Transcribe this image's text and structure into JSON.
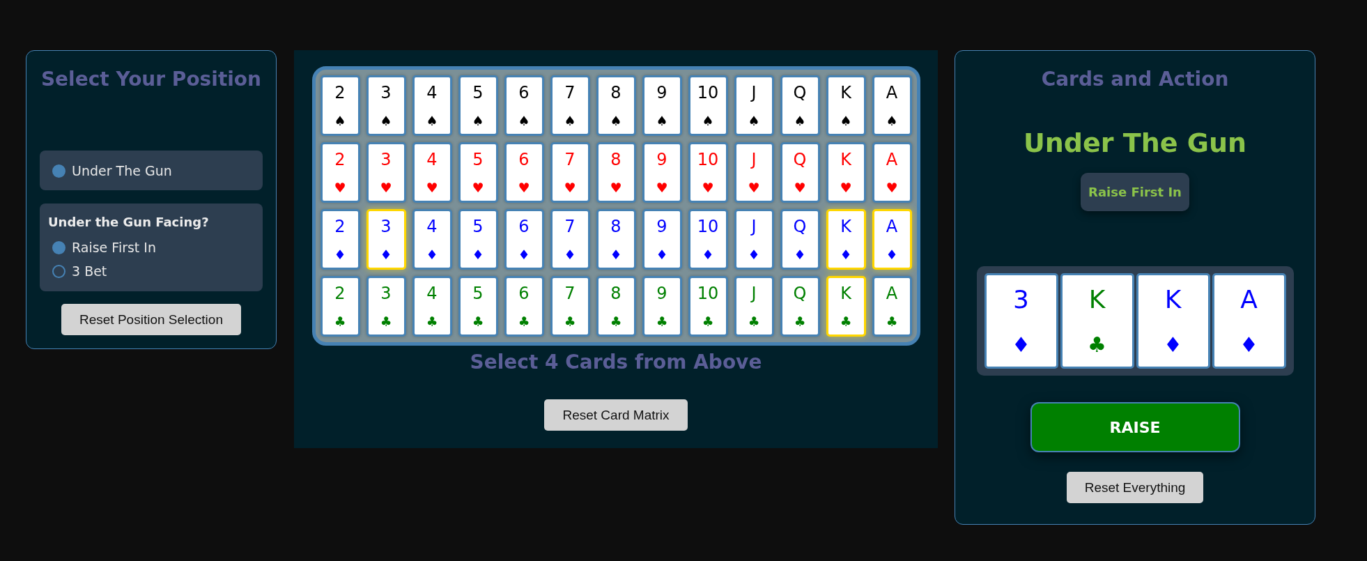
{
  "position_panel": {
    "title": "Select Your Position",
    "positions": [
      {
        "label": "Under The Gun",
        "selected": true
      }
    ],
    "facing": {
      "heading": "Under the Gun Facing?",
      "options": [
        {
          "label": "Raise First In",
          "selected": true
        },
        {
          "label": "3 Bet",
          "selected": false
        }
      ]
    },
    "reset_button": "Reset Position Selection"
  },
  "card_matrix": {
    "rows": [
      {
        "color": "#000000",
        "cards": [
          {
            "rank": "2",
            "suit": "♠",
            "selected": false
          },
          {
            "rank": "3",
            "suit": "♠",
            "selected": false
          },
          {
            "rank": "4",
            "suit": "♠",
            "selected": false
          },
          {
            "rank": "5",
            "suit": "♠",
            "selected": false
          },
          {
            "rank": "6",
            "suit": "♠",
            "selected": false
          },
          {
            "rank": "7",
            "suit": "♠",
            "selected": false
          },
          {
            "rank": "8",
            "suit": "♠",
            "selected": false
          },
          {
            "rank": "9",
            "suit": "♠",
            "selected": false
          },
          {
            "rank": "10",
            "suit": "♠",
            "selected": false
          },
          {
            "rank": "J",
            "suit": "♠",
            "selected": false
          },
          {
            "rank": "Q",
            "suit": "♠",
            "selected": false
          },
          {
            "rank": "K",
            "suit": "♠",
            "selected": false
          },
          {
            "rank": "A",
            "suit": "♠",
            "selected": false
          }
        ]
      },
      {
        "color": "#ff0000",
        "cards": [
          {
            "rank": "2",
            "suit": "♥",
            "selected": false
          },
          {
            "rank": "3",
            "suit": "♥",
            "selected": false
          },
          {
            "rank": "4",
            "suit": "♥",
            "selected": false
          },
          {
            "rank": "5",
            "suit": "♥",
            "selected": false
          },
          {
            "rank": "6",
            "suit": "♥",
            "selected": false
          },
          {
            "rank": "7",
            "suit": "♥",
            "selected": false
          },
          {
            "rank": "8",
            "suit": "♥",
            "selected": false
          },
          {
            "rank": "9",
            "suit": "♥",
            "selected": false
          },
          {
            "rank": "10",
            "suit": "♥",
            "selected": false
          },
          {
            "rank": "J",
            "suit": "♥",
            "selected": false
          },
          {
            "rank": "Q",
            "suit": "♥",
            "selected": false
          },
          {
            "rank": "K",
            "suit": "♥",
            "selected": false
          },
          {
            "rank": "A",
            "suit": "♥",
            "selected": false
          }
        ]
      },
      {
        "color": "#0000ff",
        "cards": [
          {
            "rank": "2",
            "suit": "♦",
            "selected": false
          },
          {
            "rank": "3",
            "suit": "♦",
            "selected": true
          },
          {
            "rank": "4",
            "suit": "♦",
            "selected": false
          },
          {
            "rank": "5",
            "suit": "♦",
            "selected": false
          },
          {
            "rank": "6",
            "suit": "♦",
            "selected": false
          },
          {
            "rank": "7",
            "suit": "♦",
            "selected": false
          },
          {
            "rank": "8",
            "suit": "♦",
            "selected": false
          },
          {
            "rank": "9",
            "suit": "♦",
            "selected": false
          },
          {
            "rank": "10",
            "suit": "♦",
            "selected": false
          },
          {
            "rank": "J",
            "suit": "♦",
            "selected": false
          },
          {
            "rank": "Q",
            "suit": "♦",
            "selected": false
          },
          {
            "rank": "K",
            "suit": "♦",
            "selected": true
          },
          {
            "rank": "A",
            "suit": "♦",
            "selected": true
          }
        ]
      },
      {
        "color": "#008000",
        "cards": [
          {
            "rank": "2",
            "suit": "♣",
            "selected": false
          },
          {
            "rank": "3",
            "suit": "♣",
            "selected": false
          },
          {
            "rank": "4",
            "suit": "♣",
            "selected": false
          },
          {
            "rank": "5",
            "suit": "♣",
            "selected": false
          },
          {
            "rank": "6",
            "suit": "♣",
            "selected": false
          },
          {
            "rank": "7",
            "suit": "♣",
            "selected": false
          },
          {
            "rank": "8",
            "suit": "♣",
            "selected": false
          },
          {
            "rank": "9",
            "suit": "♣",
            "selected": false
          },
          {
            "rank": "10",
            "suit": "♣",
            "selected": false
          },
          {
            "rank": "J",
            "suit": "♣",
            "selected": false
          },
          {
            "rank": "Q",
            "suit": "♣",
            "selected": false
          },
          {
            "rank": "K",
            "suit": "♣",
            "selected": true
          },
          {
            "rank": "A",
            "suit": "♣",
            "selected": false
          }
        ]
      }
    ],
    "instruction": "Select 4 Cards from Above",
    "reset_button": "Reset Card Matrix"
  },
  "action_panel": {
    "title": "Cards and Action",
    "position": "Under The Gun",
    "situation": "Raise First In",
    "hand": [
      {
        "rank": "3",
        "suit": "♦",
        "color": "#0000ff"
      },
      {
        "rank": "K",
        "suit": "♣",
        "color": "#008000"
      },
      {
        "rank": "K",
        "suit": "♦",
        "color": "#0000ff"
      },
      {
        "rank": "A",
        "suit": "♦",
        "color": "#0000ff"
      }
    ],
    "action_button": "RAISE",
    "reset_button": "Reset Everything"
  }
}
